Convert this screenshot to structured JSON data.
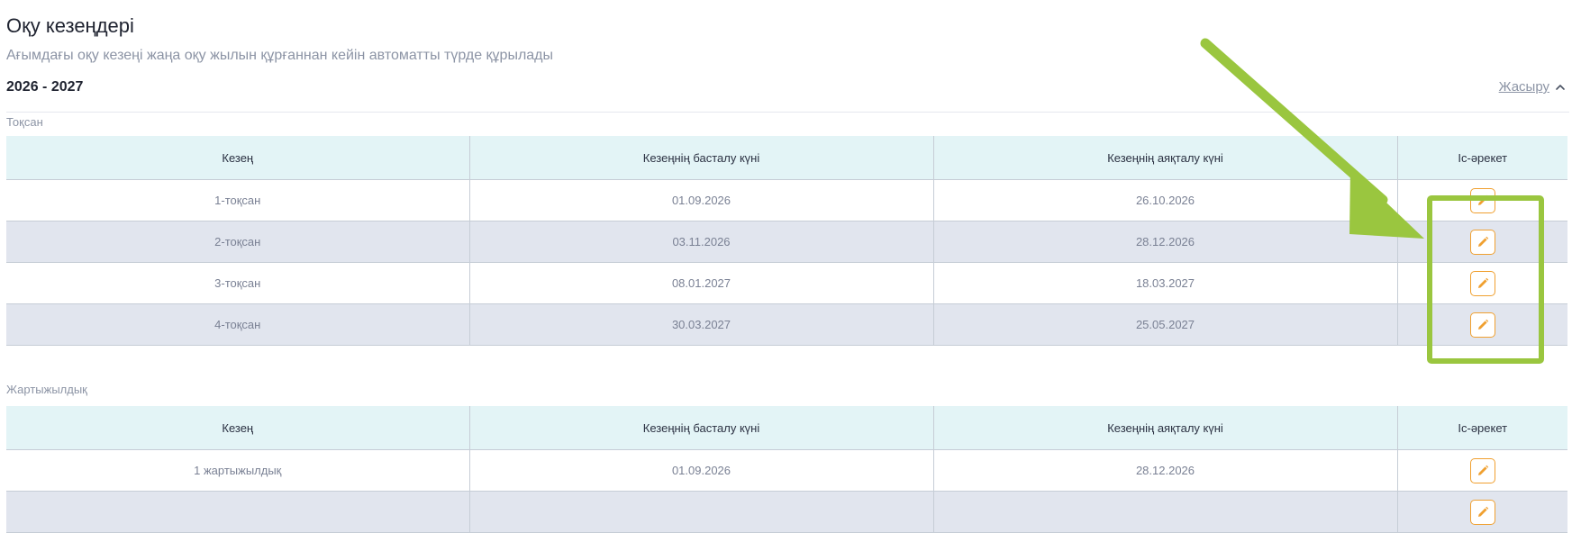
{
  "header": {
    "title": "Оқу кезеңдері",
    "subtitle": "Ағымдағы оқу кезеңі жаңа оқу жылын құрғаннан кейін автоматты түрде құрылады"
  },
  "academic_year": {
    "label": "2026 - 2027",
    "hide_label": "Жасыру"
  },
  "quarters": {
    "section_label": "Тоқсан",
    "columns": [
      "Кезең",
      "Кезеңнің басталу күні",
      "Кезеңнің аяқталу күні",
      "Іс-әрекет"
    ],
    "rows": [
      {
        "period": "1-тоқсан",
        "start": "01.09.2026",
        "end": "26.10.2026"
      },
      {
        "period": "2-тоқсан",
        "start": "03.11.2026",
        "end": "28.12.2026"
      },
      {
        "period": "3-тоқсан",
        "start": "08.01.2027",
        "end": "18.03.2027"
      },
      {
        "period": "4-тоқсан",
        "start": "30.03.2027",
        "end": "25.05.2027"
      }
    ]
  },
  "half_years": {
    "section_label": "Жартыжылдық",
    "columns": [
      "Кезең",
      "Кезеңнің басталу күні",
      "Кезеңнің аяқталу күні",
      "Іс-әрекет"
    ],
    "rows": [
      {
        "period": "1 жартыжылдық",
        "start": "01.09.2026",
        "end": "28.12.2026"
      },
      {
        "period": "",
        "start": "",
        "end": ""
      }
    ]
  },
  "icons": {
    "edit": "pencil-icon",
    "hide": "chevron-up-icon"
  },
  "colors": {
    "edit_accent": "#f0a030",
    "header_bg": "#e3f4f6",
    "alt_row_bg": "#e1e5ee",
    "annotation": "#9ac63f"
  }
}
